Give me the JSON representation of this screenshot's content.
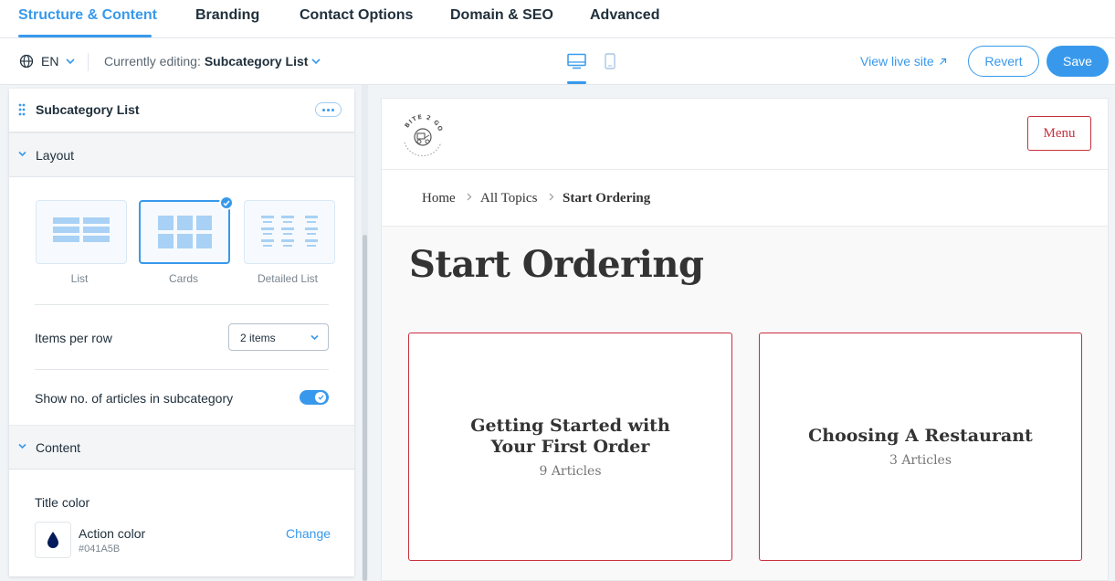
{
  "nav": {
    "tabs": [
      "Structure & Content",
      "Branding",
      "Contact Options",
      "Domain & SEO",
      "Advanced"
    ],
    "active_tab": "Structure & Content"
  },
  "toolbar": {
    "language": "EN",
    "editing_prefix": "Currently editing:",
    "editing_target": "Subcategory List",
    "view_live": "View live site",
    "revert": "Revert",
    "save": "Save"
  },
  "panel": {
    "title": "Subcategory List",
    "layout_section": "Layout",
    "layouts": [
      "List",
      "Cards",
      "Detailed List"
    ],
    "selected_layout": "Cards",
    "items_per_row_label": "Items per row",
    "items_per_row_value": "2 items",
    "show_count_label": "Show no. of articles in subcategory",
    "show_count_enabled": true,
    "content_section": "Content",
    "title_color_label": "Title color",
    "color_name": "Action color",
    "color_hex": "#041A5B",
    "change": "Change"
  },
  "preview": {
    "logo_text": "BITE 2 GO",
    "menu": "Menu",
    "breadcrumbs": [
      "Home",
      "All Topics",
      "Start Ordering"
    ],
    "page_title": "Start Ordering",
    "cards": [
      {
        "title": "Getting Started with Your First Order",
        "count": "9 Articles"
      },
      {
        "title": "Choosing A Restaurant",
        "count": "3 Articles"
      }
    ]
  },
  "colors": {
    "accent": "#3899EC",
    "brand_red": "#C8303E",
    "action_color": "#041A5B"
  }
}
